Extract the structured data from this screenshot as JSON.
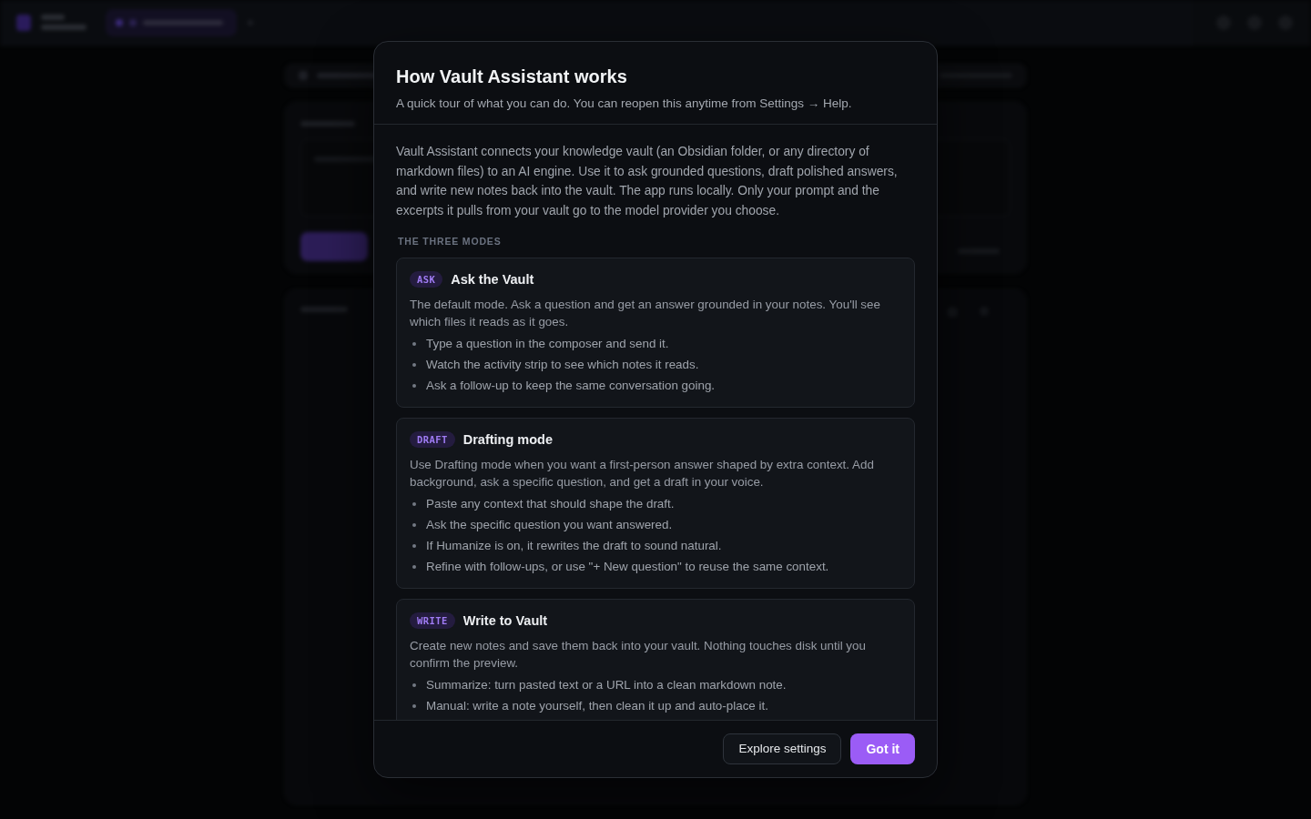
{
  "dialog": {
    "title": "How Vault Assistant works",
    "subtitle": "A quick tour of what you can do. You can reopen this anytime from Settings → Help.",
    "intro": "Vault Assistant connects your knowledge vault (an Obsidian folder, or any directory of markdown files) to an AI engine. Use it to ask grounded questions, draft polished answers, and write new notes back into the vault. The app runs locally. Only your prompt and the excerpts it pulls from your vault go to the model provider you choose.",
    "section_label": "THE THREE MODES",
    "modes": [
      {
        "badge": "ASK",
        "title": "Ask the Vault",
        "description": "The default mode. Ask a question and get an answer grounded in your notes. You'll see which files it reads as it goes.",
        "steps": [
          "Type a question in the composer and send it.",
          "Watch the activity strip to see which notes it reads.",
          "Ask a follow-up to keep the same conversation going."
        ]
      },
      {
        "badge": "DRAFT",
        "title": "Drafting mode",
        "description": "Use Drafting mode when you want a first-person answer shaped by extra context. Add background, ask a specific question, and get a draft in your voice.",
        "steps": [
          "Paste any context that should shape the draft.",
          "Ask the specific question you want answered.",
          "If Humanize is on, it rewrites the draft to sound natural.",
          "Refine with follow-ups, or use \"+ New question\" to reuse the same context."
        ]
      },
      {
        "badge": "WRITE",
        "title": "Write to Vault",
        "description": "Create new notes and save them back into your vault. Nothing touches disk until you confirm the preview.",
        "steps": [
          "Summarize: turn pasted text or a URL into a clean markdown note.",
          "Manual: write a note yourself, then clean it up and auto-place it."
        ]
      }
    ],
    "buttons": [
      {
        "label": "Explore settings",
        "kind": "secondary"
      },
      {
        "label": "Got it",
        "kind": "primary"
      }
    ]
  }
}
